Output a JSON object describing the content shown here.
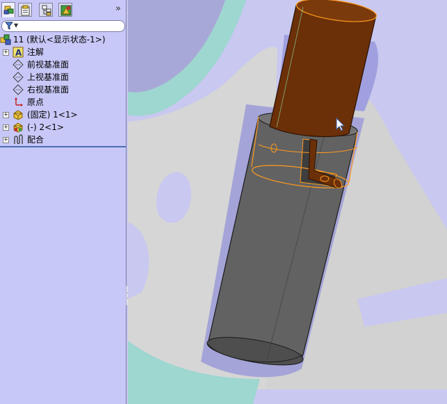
{
  "feature_manager": {
    "tabs": [
      {
        "name": "featuremanager-tab",
        "icon": "assembly-tree-icon"
      },
      {
        "name": "propertymanager-tab",
        "icon": "property-sheet-icon"
      },
      {
        "name": "configurationmanager-tab",
        "icon": "configuration-icon"
      },
      {
        "name": "display-manager-tab",
        "icon": "display-pane-icon"
      }
    ],
    "expand_glyph": "»",
    "filter_placeholder": ""
  },
  "tree": {
    "root": "11  (默认<显示状态-1>)",
    "items": [
      {
        "label": "注解",
        "icon": "annotation-icon",
        "expandable": true
      },
      {
        "label": "前视基准面",
        "icon": "plane-icon",
        "expandable": false
      },
      {
        "label": "上视基准面",
        "icon": "plane-icon",
        "expandable": false
      },
      {
        "label": "右视基准面",
        "icon": "plane-icon",
        "expandable": false
      },
      {
        "label": "原点",
        "icon": "origin-icon",
        "expandable": false
      },
      {
        "label": "(固定) 1<1>",
        "icon": "part-icon",
        "expandable": true
      },
      {
        "label": "(-) 2<1>",
        "icon": "part-icon",
        "expandable": true
      },
      {
        "label": "配合",
        "icon": "mate-icon",
        "expandable": true
      }
    ]
  },
  "colors": {
    "panel_bg": "#c8c8f8",
    "viewport_bg": "#c8c8f0",
    "outer_cylinder": "#5f5f5f",
    "inner_cylinder": "#6b3008",
    "selection_highlight": "#ff9a1f",
    "separator": "#4a6fb0"
  }
}
